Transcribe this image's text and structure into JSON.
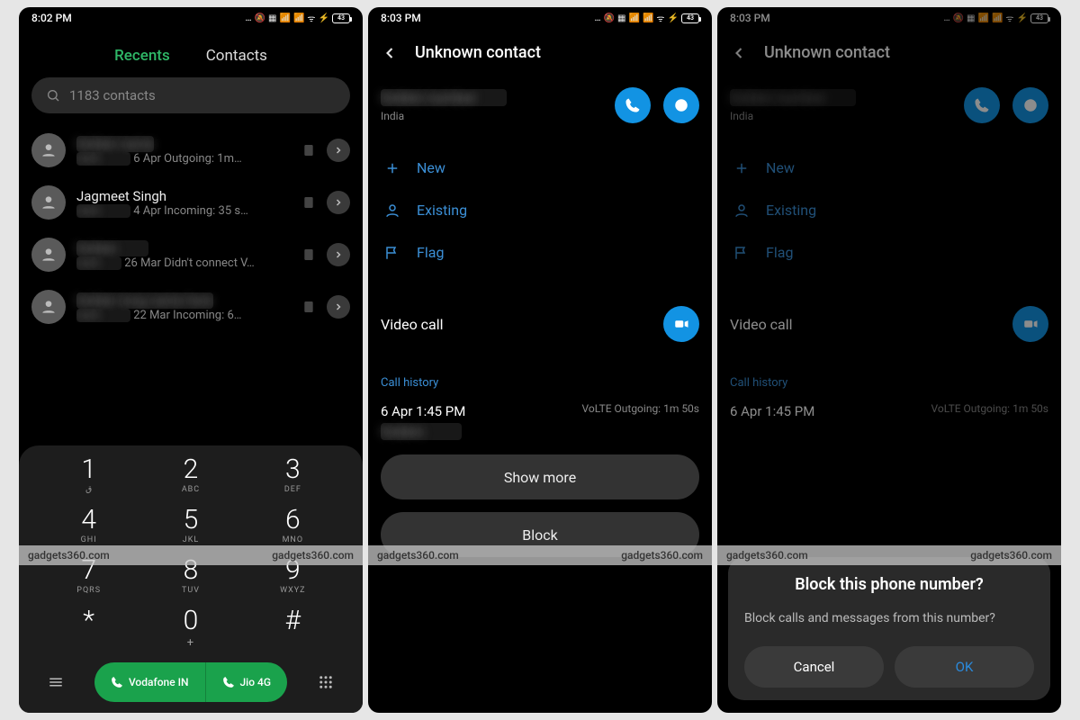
{
  "status": {
    "time1": "8:02 PM",
    "time2": "8:03 PM",
    "time3": "8:03 PM",
    "battery": "43"
  },
  "pane1": {
    "tabs": {
      "recents": "Recents",
      "contacts": "Contacts"
    },
    "search_placeholder": "1183 contacts",
    "rows": [
      {
        "name": "",
        "sub": "6 Apr Outgoing: 1m…"
      },
      {
        "name": "Jagmeet Singh",
        "sub": "4 Apr Incoming: 35 s…"
      },
      {
        "name": "",
        "sub": "26 Mar Didn't connect V…"
      },
      {
        "name": "",
        "sub": "22 Mar Incoming: 6…"
      }
    ],
    "dialpad": {
      "keys": [
        {
          "d": "1",
          "l": "ق"
        },
        {
          "d": "2",
          "l": "ABC"
        },
        {
          "d": "3",
          "l": "DEF"
        },
        {
          "d": "4",
          "l": "GHI"
        },
        {
          "d": "5",
          "l": "JKL"
        },
        {
          "d": "6",
          "l": "MNO"
        },
        {
          "d": "7",
          "l": "PQRS"
        },
        {
          "d": "8",
          "l": "TUV"
        },
        {
          "d": "9",
          "l": "WXYZ"
        },
        {
          "d": "*",
          "l": ""
        },
        {
          "d": "0",
          "l": "+"
        },
        {
          "d": "#",
          "l": ""
        }
      ],
      "sim1": "Vodafone IN",
      "sim2": "Jio 4G"
    }
  },
  "pane2": {
    "title": "Unknown contact",
    "country": "India",
    "actions": {
      "new": "New",
      "existing": "Existing",
      "flag": "Flag"
    },
    "video": "Video call",
    "history_label": "Call history",
    "history_when": "6 Apr 1:45 PM",
    "history_meta": "VoLTE  Outgoing: 1m 50s",
    "showmore": "Show more",
    "block": "Block"
  },
  "pane3": {
    "title": "Unknown contact",
    "country": "India",
    "actions": {
      "new": "New",
      "existing": "Existing",
      "flag": "Flag"
    },
    "video": "Video call",
    "history_label": "Call history",
    "history_when": "6 Apr 1:45 PM",
    "history_meta": "VoLTE  Outgoing: 1m 50s",
    "dialog": {
      "title": "Block this phone number?",
      "body": "Block calls and messages from this number?",
      "cancel": "Cancel",
      "ok": "OK"
    }
  },
  "watermark": "gadgets360.com"
}
